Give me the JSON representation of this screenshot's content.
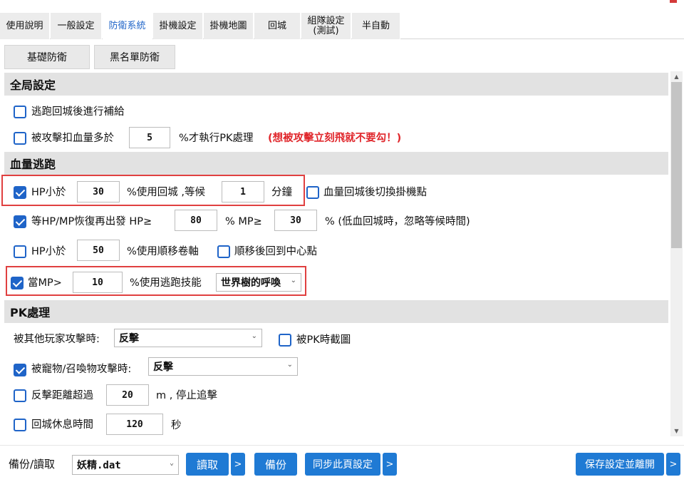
{
  "tabs": [
    {
      "label": "使用說明"
    },
    {
      "label": "一般設定"
    },
    {
      "label": "防衛系統"
    },
    {
      "label": "掛機設定"
    },
    {
      "label": "掛機地圖"
    },
    {
      "label": "回城"
    },
    {
      "label": "組隊設定\n(測試)"
    },
    {
      "label": "半自動"
    }
  ],
  "subtabs": [
    {
      "label": "基礎防衛"
    },
    {
      "label": "黑名單防衛"
    }
  ],
  "sections": {
    "global": "全局設定",
    "escape": "血量逃跑",
    "pk": "PK處理"
  },
  "global": {
    "supply_label": "逃跑回城後進行補給",
    "damage_label": "被攻擊扣血量多於",
    "damage_value": "5",
    "damage_suffix": "%才執行PK處理",
    "damage_warning": "(想被攻擊立刻飛就不要勾！)"
  },
  "escape": {
    "hp_label": "HP小於",
    "hp_value": "30",
    "hp_mid": "%使用回城 ,等候",
    "wait_value": "1",
    "wait_unit": "分鐘",
    "switch_label": "血量回城後切換掛機點",
    "recover_label": "等HP/MP恢復再出發 HP≥",
    "recover_hp": "80",
    "recover_mid": "% MP≥",
    "recover_mp": "30",
    "recover_note": "% (低血回城時，忽略等候時間)",
    "hp2_label": "HP小於",
    "hp2_value": "50",
    "hp2_mid": "%使用順移卷軸",
    "center_label": "順移後回到中心點",
    "mp_label": "當MP>",
    "mp_value": "10",
    "mp_mid": "%使用逃跑技能",
    "skill": "世界樹的呼喚"
  },
  "pk": {
    "player_label": "被其他玩家攻擊時:",
    "player_action": "反擊",
    "screenshot_label": "被PK時截圖",
    "pet_label": "被寵物/召喚物攻擊時:",
    "pet_action": "反擊",
    "distance_label": "反擊距離超過",
    "distance_value": "20",
    "distance_suffix": "m , 停止追擊",
    "rest_label": "回城休息時間",
    "rest_value": "120",
    "rest_unit": "秒"
  },
  "footer": {
    "backup_label": "備份/讀取",
    "file": "妖精.dat",
    "read": "讀取",
    "backup": "備份",
    "sync": "同步此頁設定",
    "save": "保存設定並離開",
    "more": ">"
  },
  "colors": {
    "accent": "#1f64c8",
    "button": "#1f7ad4",
    "warning": "#e0262b",
    "highlight": "#e04040"
  }
}
